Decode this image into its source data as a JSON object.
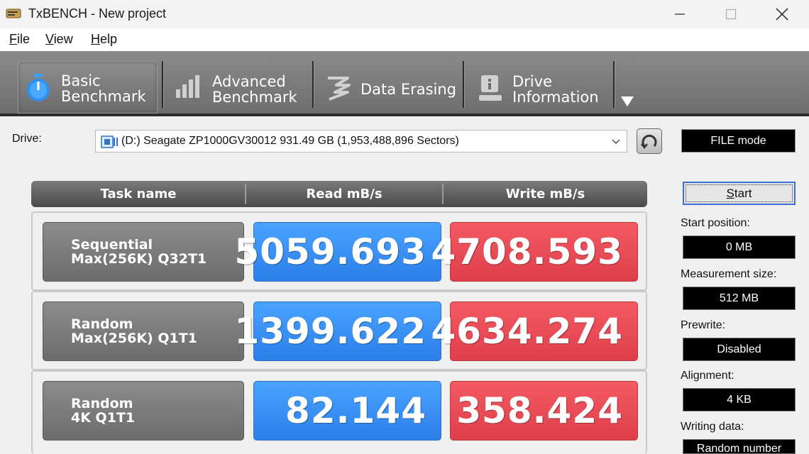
{
  "window": {
    "title": "TxBENCH - New project",
    "app_icon": "hard-drive-icon"
  },
  "menu": {
    "items": [
      {
        "accel": "F",
        "rest": "ile"
      },
      {
        "accel": "V",
        "rest": "iew"
      },
      {
        "accel": "H",
        "rest": "elp"
      }
    ]
  },
  "tabs": [
    {
      "line1": "Basic",
      "line2": "Benchmark",
      "icon": "stopwatch-icon",
      "active": true
    },
    {
      "line1": "Advanced",
      "line2": "Benchmark",
      "icon": "bar-chart-icon",
      "active": false
    },
    {
      "line1": "Data Erasing",
      "line2": "",
      "icon": "eraser-icon",
      "active": false
    },
    {
      "line1": "Drive",
      "line2": "Information",
      "icon": "drive-info-icon",
      "active": false
    }
  ],
  "drive": {
    "label": "Drive:",
    "selected": "(D:) Seagate ZP1000GV30012  931.49 GB (1,953,488,896 Sectors)",
    "mode": "FILE mode"
  },
  "table": {
    "headers": [
      "Task name",
      "Read mB/s",
      "Write mB/s"
    ],
    "rows": [
      {
        "name1": "Sequential",
        "name2": "Max(256K) Q32T1",
        "read": "5059.693",
        "write": "4708.593"
      },
      {
        "name1": "Random",
        "name2": "Max(256K) Q1T1",
        "read": "1399.622",
        "write": "4634.274"
      },
      {
        "name1": "Random",
        "name2": "4K Q1T1",
        "read": "82.144",
        "write": "358.424"
      }
    ]
  },
  "panel": {
    "start_accel": "S",
    "start_rest": "tart",
    "start_position_label": "Start position:",
    "start_position": "0 MB",
    "measurement_size_label": "Measurement size:",
    "measurement_size": "512 MB",
    "prewrite_label": "Prewrite:",
    "prewrite": "Disabled",
    "alignment_label": "Alignment:",
    "alignment": "4 KB",
    "writing_data_label": "Writing data:",
    "writing_data": "Random number"
  },
  "colors": {
    "read": "#3a8ff5",
    "write": "#e84a55",
    "toolbar": "#7a7a7a"
  }
}
